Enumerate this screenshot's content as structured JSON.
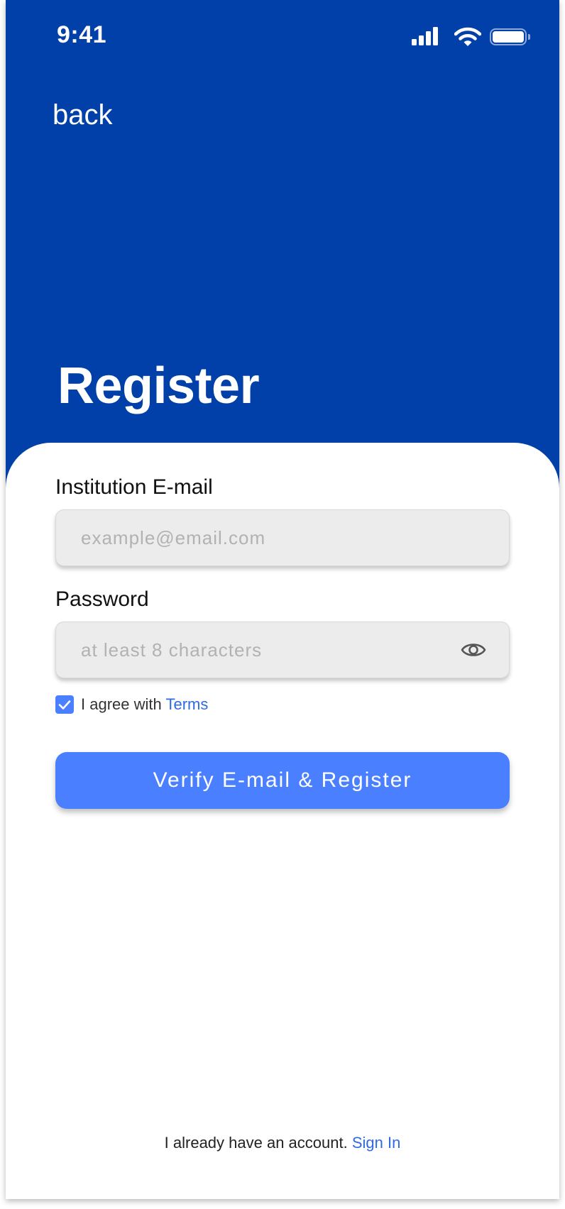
{
  "status_bar": {
    "time": "9:41",
    "icons": [
      "signal-icon",
      "wifi-icon",
      "battery-icon"
    ]
  },
  "header": {
    "back_label": "back",
    "title": "Register"
  },
  "form": {
    "email": {
      "label": "Institution E-mail",
      "placeholder": "example@email.com",
      "value": ""
    },
    "password": {
      "label": "Password",
      "placeholder": "at least 8 characters",
      "value": "",
      "toggle_icon": "eye-icon"
    },
    "agree": {
      "checked": true,
      "text": "I agree with",
      "link": "Terms"
    },
    "submit_label": "Verify E-mail & Register"
  },
  "footer": {
    "text": "I already have an account.",
    "link": "Sign In"
  },
  "colors": {
    "header_bg": "#0040a8",
    "accent": "#4a80ff",
    "link": "#2f6be0",
    "input_bg": "#ececec"
  }
}
